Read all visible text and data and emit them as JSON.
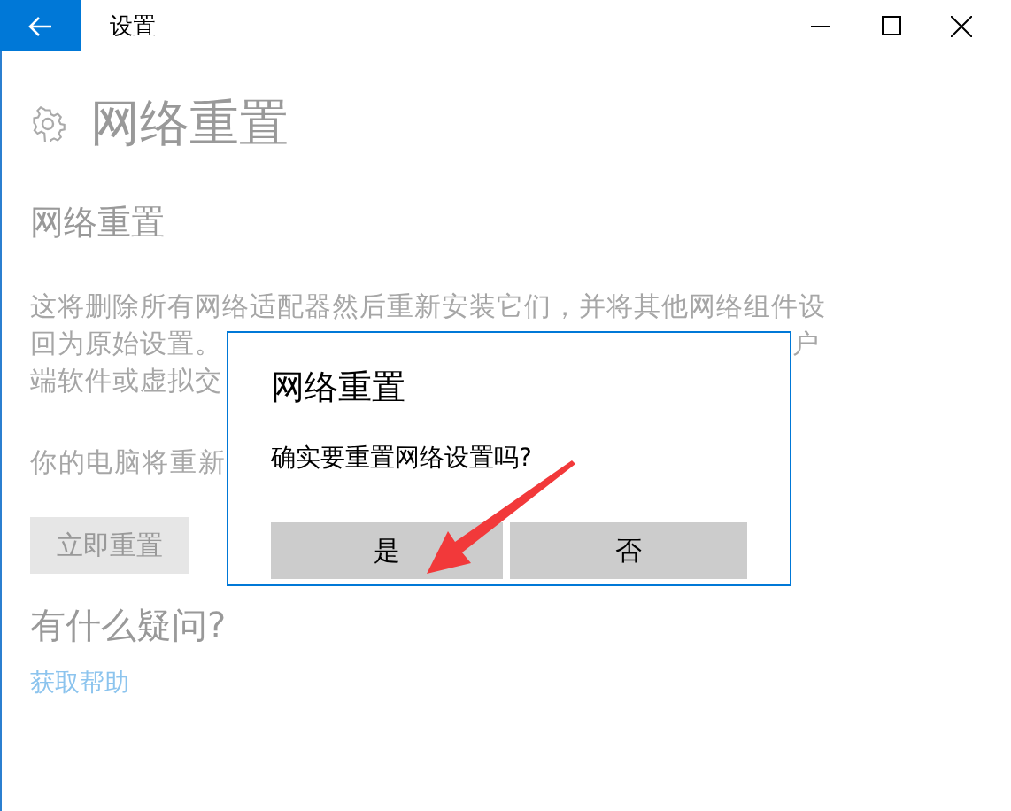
{
  "window": {
    "title": "设置"
  },
  "page": {
    "heading": "网络重置",
    "section_title": "网络重置",
    "description_lines": [
      {
        "left": "这将删除所有网络适配器然后重新安装它们，并将其他网络组件设"
      },
      {
        "left": "回为原始设置。",
        "right": "户"
      },
      {
        "left": "端软件或虚拟交"
      }
    ],
    "restart_note": "你的电脑将重新",
    "reset_button": "立即重置",
    "help_heading": "有什么疑问?",
    "help_link": "获取帮助"
  },
  "dialog": {
    "title": "网络重置",
    "message": "确实要重置网络设置吗?",
    "buttons": [
      {
        "label": "是"
      },
      {
        "label": "否"
      }
    ]
  }
}
